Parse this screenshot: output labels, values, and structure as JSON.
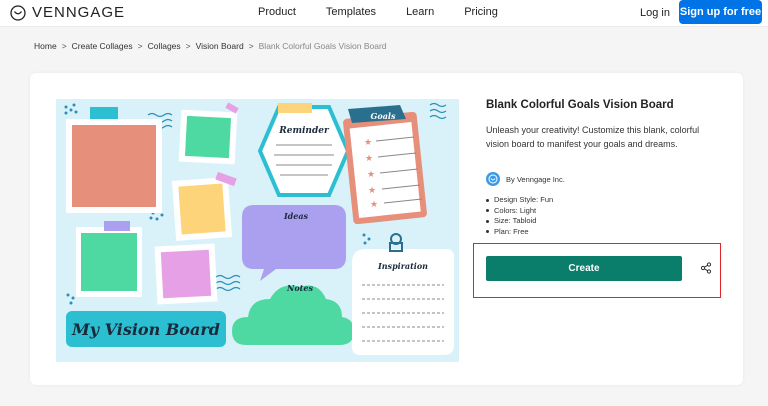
{
  "header": {
    "logo_text": "VENNGAGE",
    "nav": [
      "Product",
      "Templates",
      "Learn",
      "Pricing"
    ],
    "login": "Log in",
    "signup": "Sign up for free"
  },
  "breadcrumb": {
    "items": [
      "Home",
      "Create Collages",
      "Collages",
      "Vision Board"
    ],
    "separator": ">",
    "current": "Blank Colorful Goals Vision Board"
  },
  "template": {
    "title": "Blank Colorful Goals Vision Board",
    "description": "Unleash your creativity! Customize this blank, colorful vision board to manifest your goals and dreams.",
    "author": "By Venngage Inc.",
    "specs": [
      "Design Style: Fun",
      "Colors: Light",
      "Size: Tabloid",
      "Plan: Free"
    ],
    "create_label": "Create"
  },
  "preview": {
    "reminder": "Reminder",
    "goals": "Goals",
    "ideas": "Ideas",
    "inspiration": "Inspiration",
    "notes": "Notes",
    "board_title": "My Vision Board"
  },
  "colors": {
    "accent": "#0073e6",
    "create": "#0b7d6b",
    "highlight": "#e0242a",
    "preview_bg": "#d9f1f9"
  }
}
